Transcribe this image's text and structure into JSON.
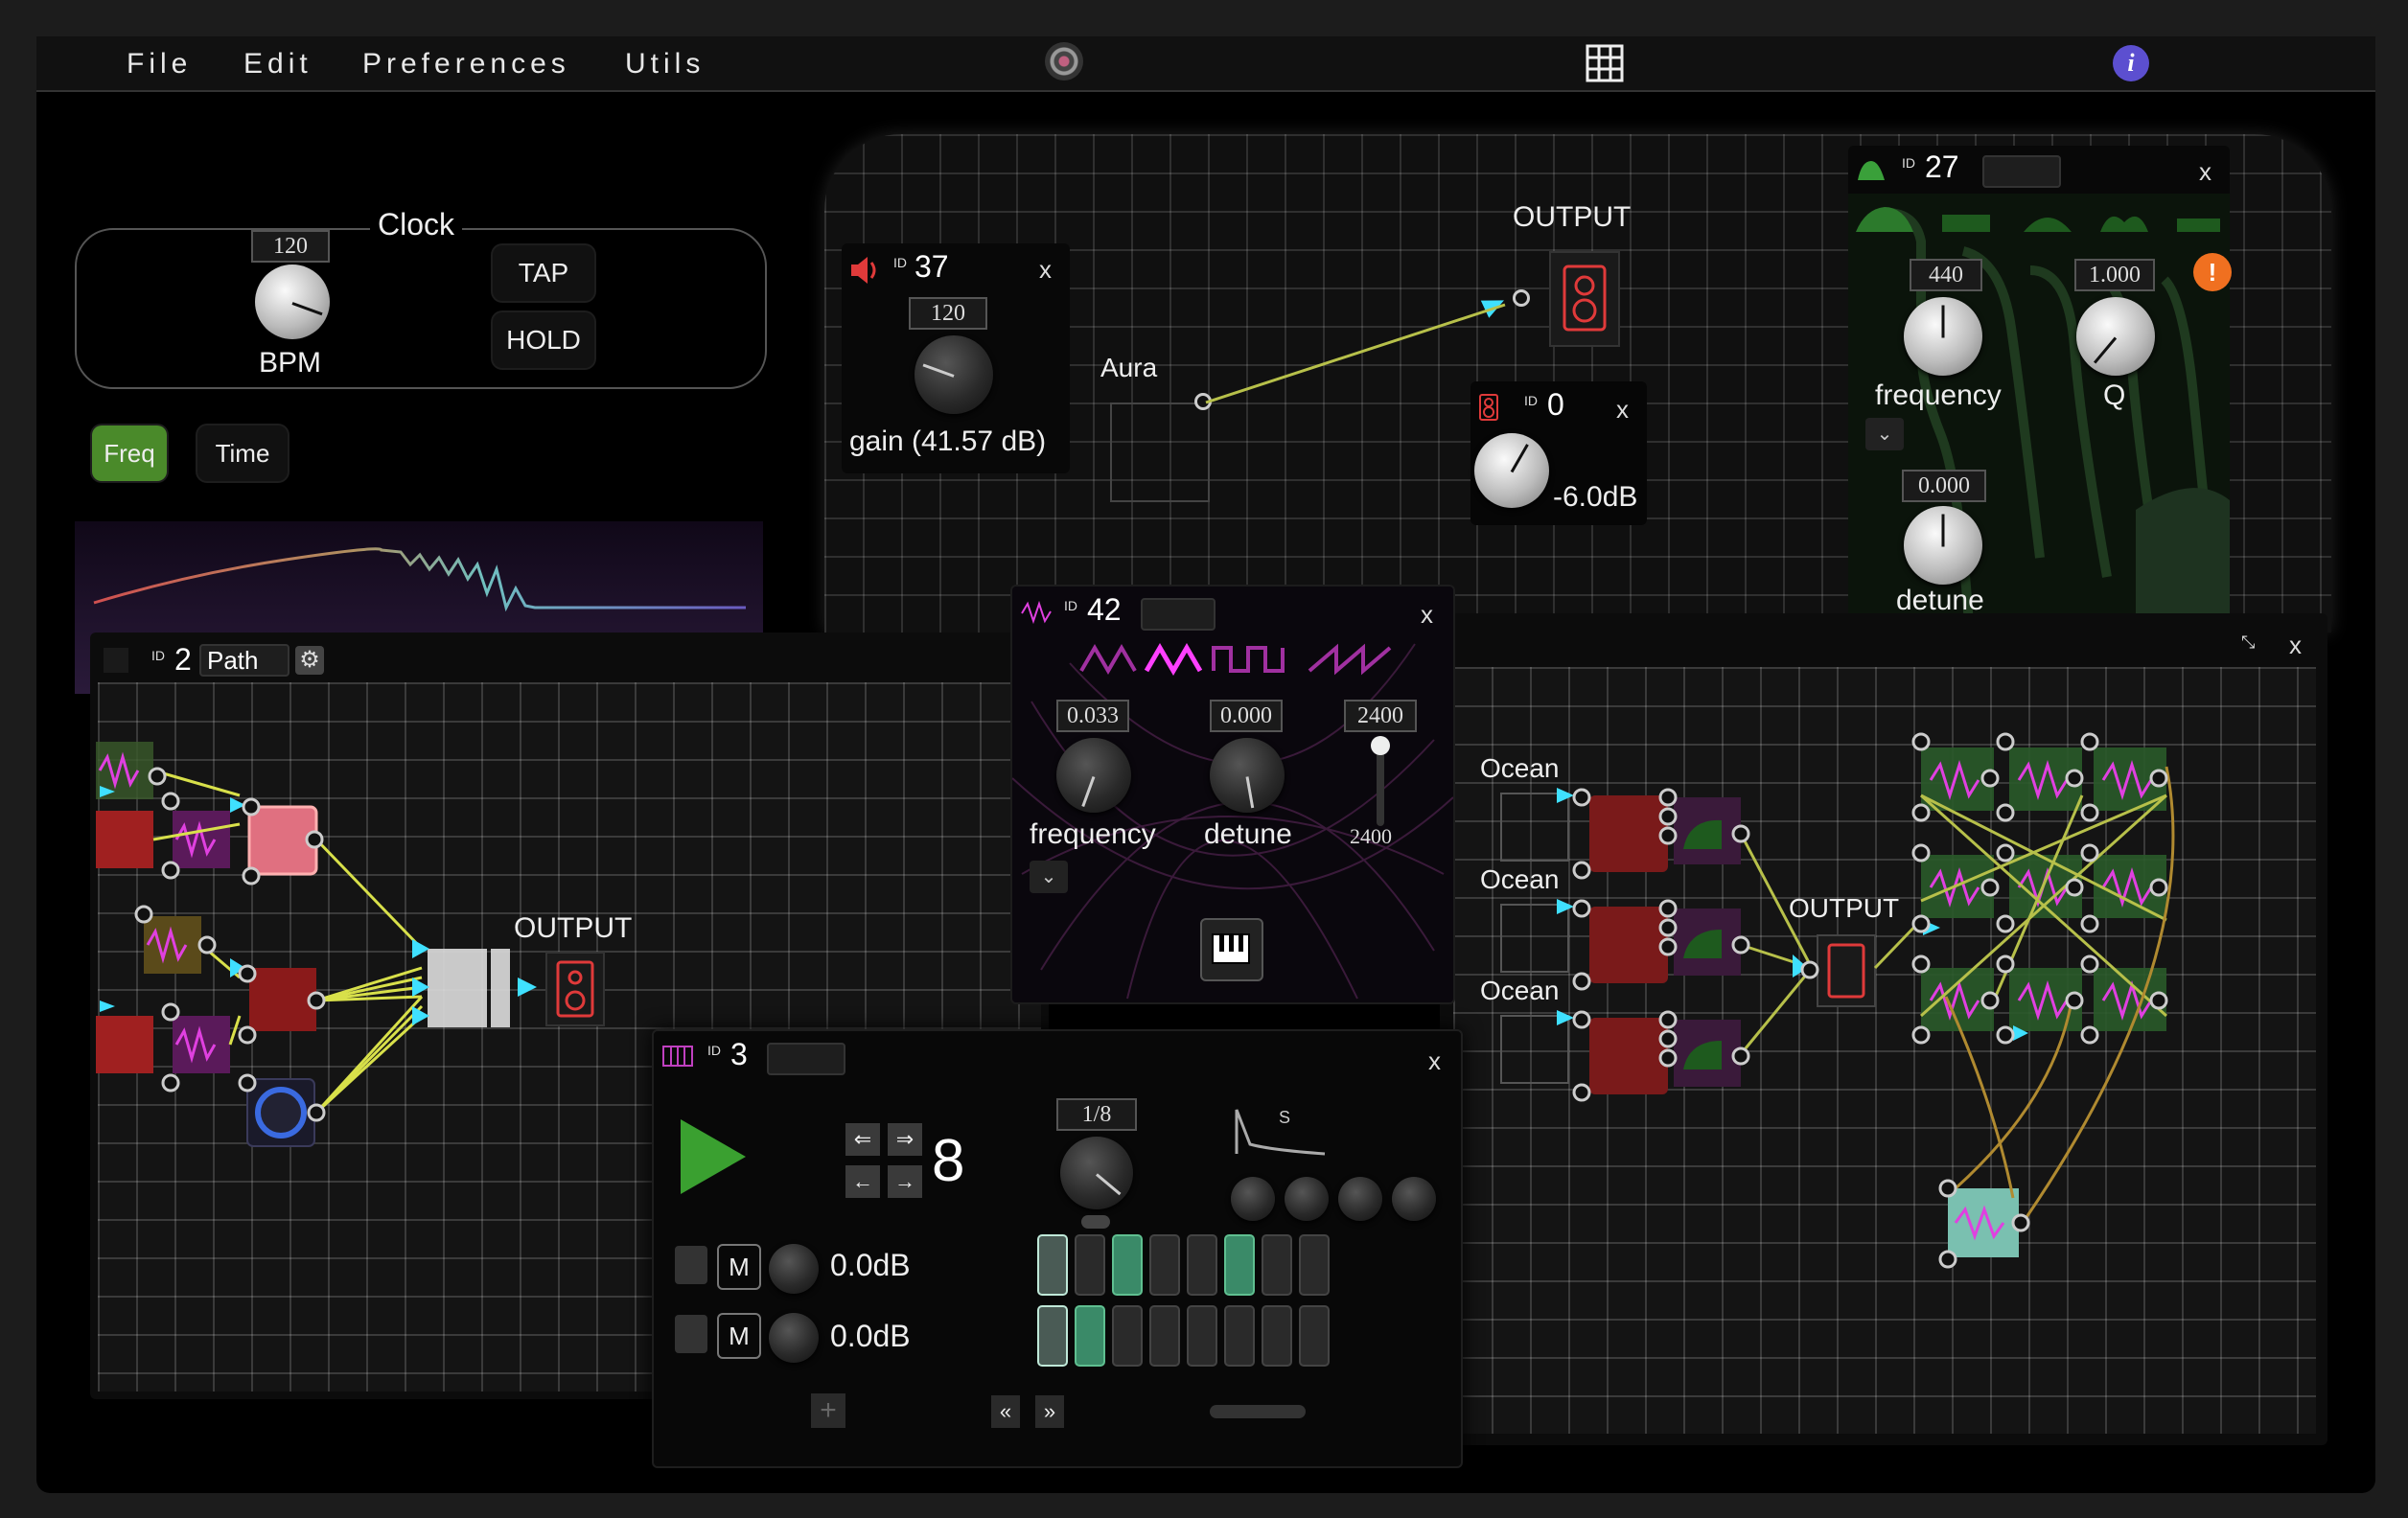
{
  "menu": {
    "file": "File",
    "edit": "Edit",
    "preferences": "Preferences",
    "utils": "Utils"
  },
  "clock": {
    "title": "Clock",
    "bpm_value": "120",
    "bpm_label": "BPM",
    "tap_label": "TAP",
    "hold_label": "HOLD"
  },
  "view_toggle": {
    "freq_label": "Freq",
    "time_label": "Time"
  },
  "gain_panel": {
    "id": "37",
    "gain_value": "120",
    "gain_label": "gain (41.57 dB)",
    "close": "x"
  },
  "main_patch": {
    "output_label": "OUTPUT",
    "aura_label": "Aura"
  },
  "vol_panel": {
    "id": "0",
    "value_label": "-6.0dB",
    "close": "x"
  },
  "filter_panel": {
    "id": "27",
    "freq_value": "440",
    "freq_label": "frequency",
    "q_value": "1.000",
    "q_label": "Q",
    "detune_value": "0.000",
    "detune_label": "detune",
    "close": "x"
  },
  "osc_panel": {
    "id": "42",
    "freq_value": "0.033",
    "freq_label": "frequency",
    "detune_value": "0.000",
    "detune_label": "detune",
    "slider_value": "2400",
    "slider_label": "2400",
    "close": "x"
  },
  "path_panel": {
    "id": "2",
    "name": "Path",
    "output_label": "OUTPUT"
  },
  "ocean_panel": {
    "ocean1": "Ocean",
    "ocean2": "Ocean",
    "ocean3": "Ocean",
    "output_label": "OUTPUT",
    "close": "x"
  },
  "seq_panel": {
    "id": "3",
    "step_count": "8",
    "rate_value": "1/8",
    "s_label": "S",
    "track1_mute": "M",
    "track1_gain": "0.0dB",
    "track2_mute": "M",
    "track2_gain": "0.0dB",
    "close": "x",
    "prev_label": "«",
    "next_label": "»",
    "add_label": "+"
  },
  "sequencer": {
    "row1": [
      1,
      0,
      1,
      0,
      0,
      1,
      0,
      0
    ],
    "row2": [
      1,
      1,
      0,
      0,
      0,
      0,
      0,
      0
    ]
  },
  "colors": {
    "accent_green": "#4a8a2a",
    "cyan": "#3fe0ff",
    "red_node": "#c0282a",
    "magenta_wave": "#e040e0"
  },
  "icons": [
    "record-icon",
    "grid-icon",
    "info-icon",
    "speaker-icon",
    "gear-icon",
    "piano-icon",
    "play-icon",
    "trash-icon",
    "warning-icon"
  ]
}
